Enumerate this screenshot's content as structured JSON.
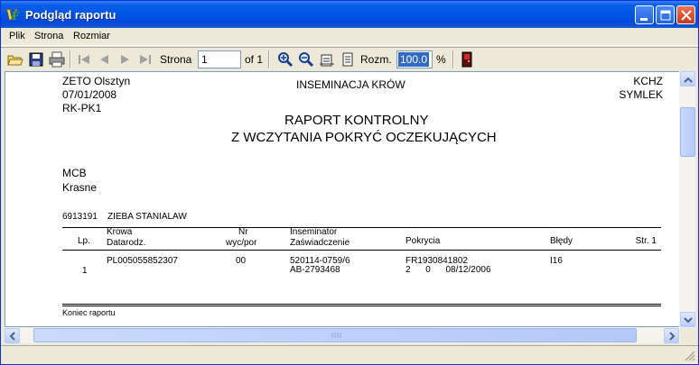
{
  "window": {
    "title": "Podgląd raportu"
  },
  "menu": [
    {
      "label": "Plik"
    },
    {
      "label": "Strona"
    },
    {
      "label": "Rozmiar"
    }
  ],
  "toolbar": {
    "page_label": "Strona",
    "page_value": "1",
    "page_of": "of 1",
    "size_label": "Rozm.",
    "zoom_value": "100.0",
    "zoom_unit": "%"
  },
  "report": {
    "company": "ZETO Olsztyn",
    "date": "07/01/2008",
    "code": "RK-PK1",
    "module": "INSEMINACJA  KRÓW",
    "right_code1": "KCHZ",
    "right_code2": "SYMLEK",
    "title_line1": "RAPORT  KONTROLNY",
    "title_line2": "Z  WCZYTANIA  POKRYĆ  OCZEKUJĄCYCH",
    "place1": "MCB",
    "place2": "Krasne",
    "owner_id": "6913191",
    "owner_name": "ZIEBA STANIALAW",
    "columns": {
      "lp": "Lp.",
      "krowa": "Krowa",
      "datarodz": "Datarodz.",
      "nr": "Nr",
      "wyc": "wyc/por",
      "inseminator": "Inseminator",
      "zaswiadczenie": "Zaświadczenie",
      "pokrycia": "Pokrycia",
      "bledy": "Błędy",
      "str": "Str. 1"
    },
    "row": {
      "lp": "1",
      "krowa": "PL005055852307",
      "nr": "00",
      "inseminator": "520114-0759/6",
      "zaswiadczenie": "AB-2793468",
      "pokrycia": "FR1930841802",
      "pokrycia_detail": "2      0      08/12/2006",
      "bledy": "I16"
    },
    "footer": "Koniec raportu"
  }
}
